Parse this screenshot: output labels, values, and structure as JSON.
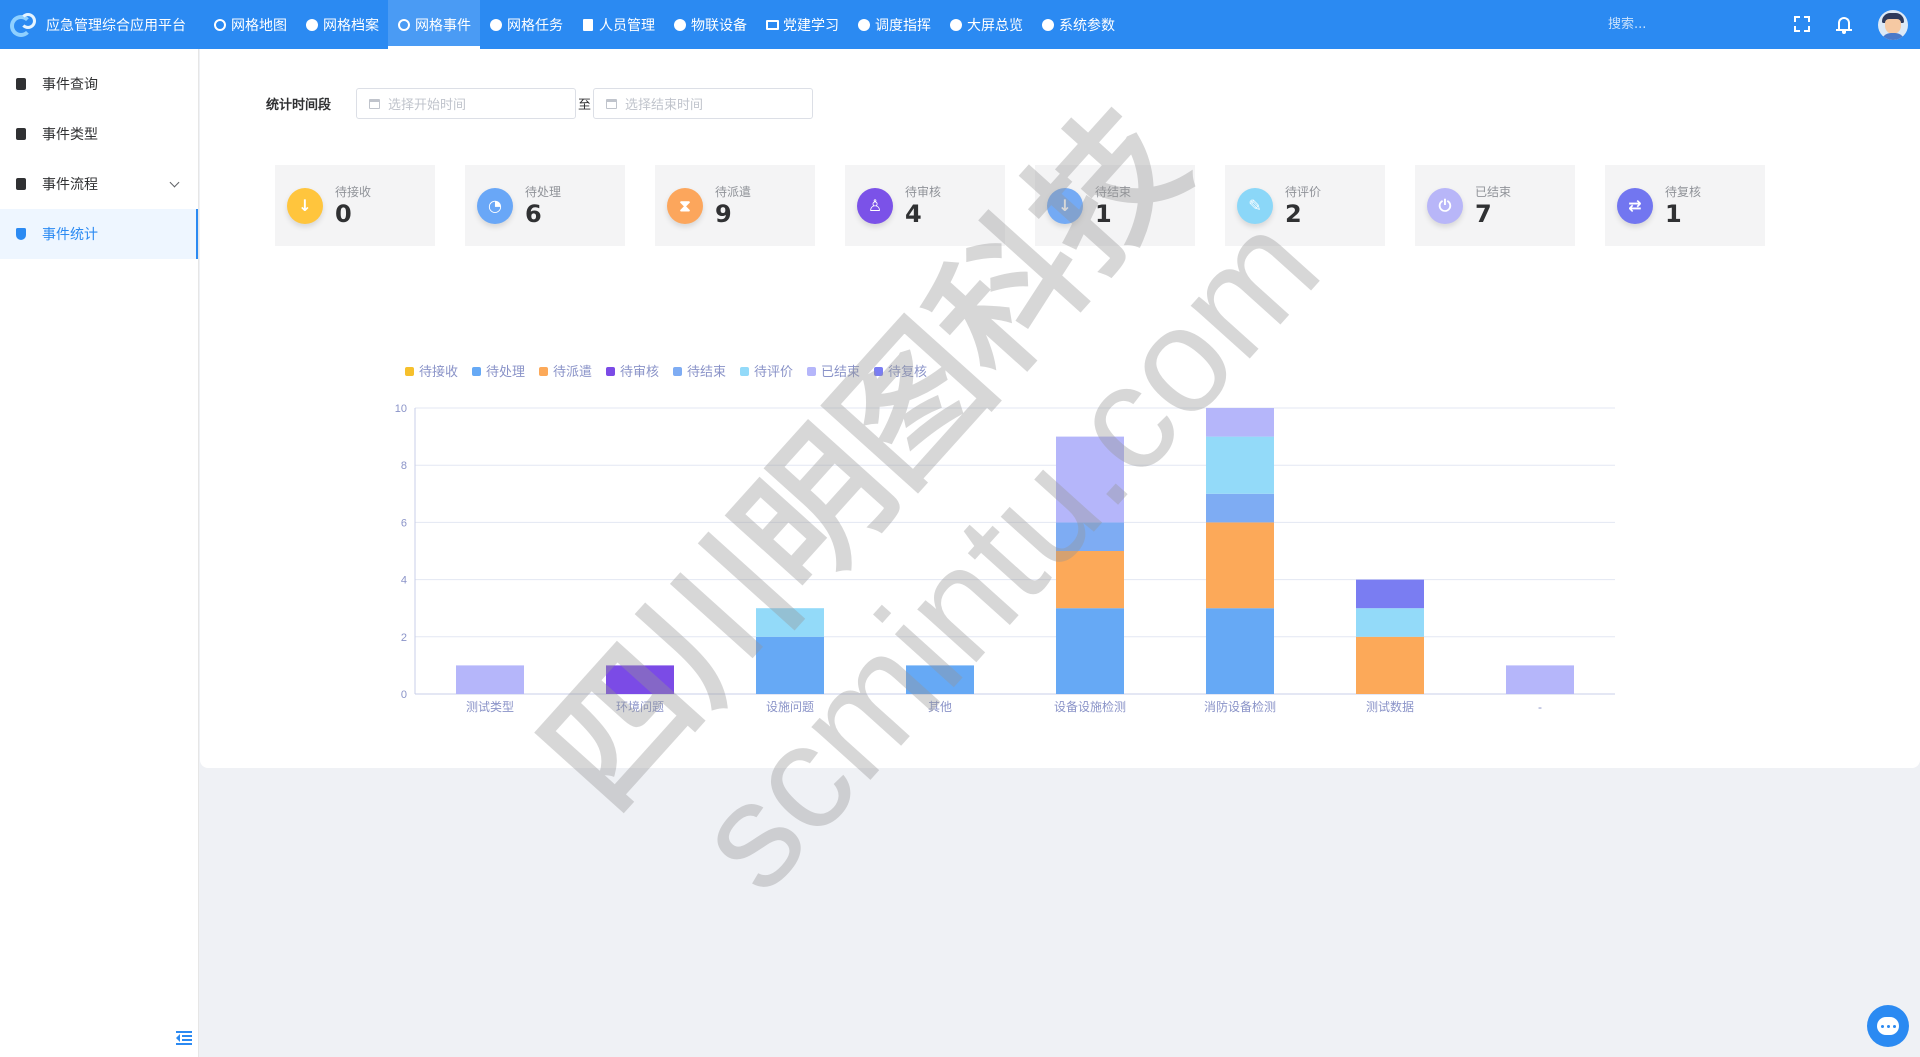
{
  "app": {
    "title": "应急管理综合应用平台"
  },
  "nav": {
    "items": [
      {
        "label": "网格地图",
        "icon": "globe-icon",
        "active": false
      },
      {
        "label": "网格档案",
        "icon": "archive-icon",
        "active": false
      },
      {
        "label": "网格事件",
        "icon": "event-icon",
        "active": true
      },
      {
        "label": "网格任务",
        "icon": "cloud-icon",
        "active": false
      },
      {
        "label": "人员管理",
        "icon": "document-icon",
        "active": false
      },
      {
        "label": "物联设备",
        "icon": "device-icon",
        "active": false
      },
      {
        "label": "党建学习",
        "icon": "book-icon",
        "active": false
      },
      {
        "label": "调度指挥",
        "icon": "dispatch-icon",
        "active": false
      },
      {
        "label": "大屏总览",
        "icon": "screen-icon",
        "active": false
      },
      {
        "label": "系统参数",
        "icon": "settings-icon",
        "active": false
      }
    ],
    "search_placeholder": "搜索..."
  },
  "sidebar": {
    "items": [
      {
        "label": "事件查询",
        "icon": "query-icon",
        "active": false
      },
      {
        "label": "事件类型",
        "icon": "type-icon",
        "active": false
      },
      {
        "label": "事件流程",
        "icon": "flow-icon",
        "active": false,
        "expandable": true
      },
      {
        "label": "事件统计",
        "icon": "stats-icon",
        "active": true
      }
    ]
  },
  "filter": {
    "label": "统计时间段",
    "start_placeholder": "选择开始时间",
    "separator": "至",
    "end_placeholder": "选择结束时间"
  },
  "stats": [
    {
      "label": "待接收",
      "value": "0",
      "color": "#ffc53d",
      "glyph": "↓"
    },
    {
      "label": "待处理",
      "value": "6",
      "color": "#69a7f7",
      "glyph": "◔"
    },
    {
      "label": "待派遣",
      "value": "9",
      "color": "#fca65c",
      "glyph": "⧗"
    },
    {
      "label": "待审核",
      "value": "4",
      "color": "#7b52e8",
      "glyph": "♙"
    },
    {
      "label": "待结束",
      "value": "1",
      "color": "#74aaf4",
      "glyph": "↓"
    },
    {
      "label": "待评价",
      "value": "2",
      "color": "#8bd7f8",
      "glyph": "✎"
    },
    {
      "label": "已结束",
      "value": "7",
      "color": "#b8b6f8",
      "glyph": "⏻"
    },
    {
      "label": "待复核",
      "value": "1",
      "color": "#7276f0",
      "glyph": "⇄"
    }
  ],
  "chart_data": {
    "type": "bar",
    "stacked": true,
    "legend_position": "top-left",
    "grid": true,
    "ylim": [
      0,
      10
    ],
    "yticks": [
      0,
      2,
      4,
      6,
      8,
      10
    ],
    "categories": [
      "测试类型",
      "环境问题",
      "设施问题",
      "其他",
      "设备设施检测",
      "消防设备检测",
      "测试数据",
      "-"
    ],
    "series": [
      {
        "name": "待接收",
        "color": "#f6c02c",
        "values": [
          0,
          0,
          0,
          0,
          0,
          0,
          0,
          0
        ]
      },
      {
        "name": "待处理",
        "color": "#66a9f5",
        "values": [
          0,
          0,
          2,
          1,
          3,
          3,
          0,
          0
        ]
      },
      {
        "name": "待派遣",
        "color": "#fca959",
        "values": [
          0,
          0,
          0,
          0,
          2,
          3,
          2,
          0
        ]
      },
      {
        "name": "待审核",
        "color": "#7b4be6",
        "values": [
          0,
          1,
          0,
          0,
          0,
          0,
          0,
          0
        ]
      },
      {
        "name": "待结束",
        "color": "#7eacf3",
        "values": [
          0,
          0,
          0,
          0,
          1,
          1,
          0,
          0
        ]
      },
      {
        "name": "待评价",
        "color": "#93daf9",
        "values": [
          0,
          0,
          1,
          0,
          0,
          2,
          1,
          0
        ]
      },
      {
        "name": "已结束",
        "color": "#b5b6fa",
        "values": [
          1,
          0,
          0,
          0,
          3,
          1,
          0,
          1
        ]
      },
      {
        "name": "待复核",
        "color": "#7a7df2",
        "values": [
          0,
          0,
          0,
          0,
          0,
          0,
          1,
          0
        ]
      }
    ]
  },
  "watermark": {
    "line1": "四川明图科技",
    "line2": "scmintu.com"
  }
}
